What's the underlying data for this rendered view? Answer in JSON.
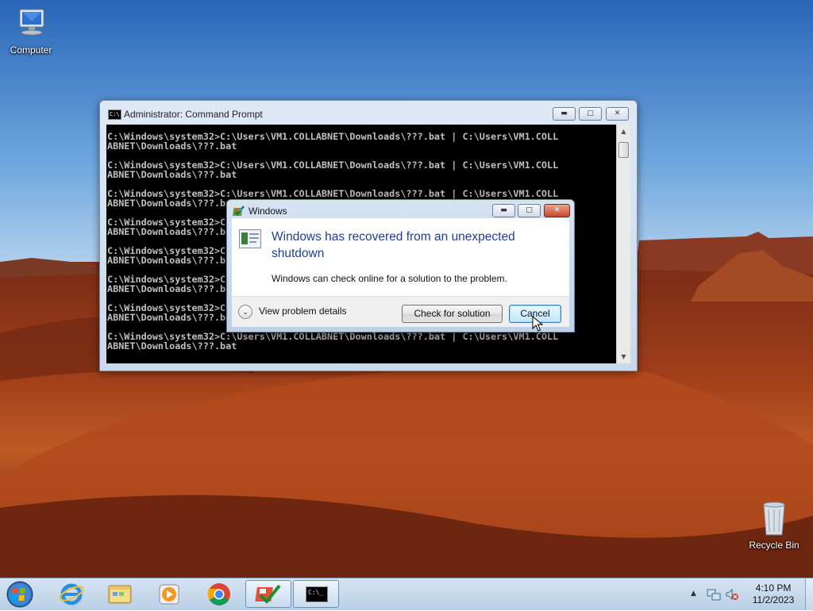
{
  "desktop": {
    "icons": [
      {
        "label": "Computer"
      },
      {
        "label": "Recycle Bin"
      }
    ]
  },
  "cmd_window": {
    "title": "Administrator: Command Prompt",
    "lines": [
      "C:\\Windows\\system32>C:\\Users\\VM1.COLLABNET\\Downloads\\???.bat | C:\\Users\\VM1.COLL",
      "ABNET\\Downloads\\???.bat",
      "",
      "C:\\Windows\\system32>C:\\Users\\VM1.COLLABNET\\Downloads\\???.bat | C:\\Users\\VM1.COLL",
      "ABNET\\Downloads\\???.bat",
      "",
      "C:\\Windows\\system32>C:\\Users\\VM1.COLLABNET\\Downloads\\???.bat | C:\\Users\\VM1.COLL",
      "ABNET\\Downloads\\???.bat",
      "",
      "C:\\Windows\\system32>C:\\Users\\VM1.COLLABNET\\Downloads\\???.bat | C:\\Users\\VM1.COLL",
      "ABNET\\Downloads\\???.bat",
      "",
      "C:\\Windows\\system32>C:\\Users\\VM1.COLLABNET\\Downloads\\???.bat | C:\\Users\\VM1.COLL",
      "ABNET\\Downloads\\???.bat",
      "",
      "C:\\Windows\\system32>C:\\Users\\VM1.COLLABNET\\Downloads\\???.bat | C:\\Users\\VM1.COLL",
      "ABNET\\Downloads\\???.bat",
      "",
      "C:\\Windows\\system32>C:\\Users\\VM1.COLLABNET\\Downloads\\???.bat | C:\\Users\\VM1.COLL",
      "ABNET\\Downloads\\???.bat",
      "",
      "C:\\Windows\\system32>C:\\Users\\VM1.COLLABNET\\Downloads\\???.bat | C:\\Users\\VM1.COLL",
      "ABNET\\Downloads\\???.bat"
    ],
    "scroll_position": 0.05
  },
  "dialog": {
    "title": "Windows",
    "heading": "Windows has recovered from an unexpected shutdown",
    "message": "Windows can check online for a solution to the problem.",
    "details_label": "View problem details",
    "check_button": "Check for solution",
    "cancel_button": "Cancel"
  },
  "taskbar": {
    "pinned": [
      {
        "icon": "internet-explorer-icon"
      },
      {
        "icon": "file-explorer-icon"
      },
      {
        "icon": "media-player-icon"
      },
      {
        "icon": "chrome-icon"
      },
      {
        "icon": "action-center-icon"
      },
      {
        "icon": "command-prompt-icon"
      }
    ],
    "cmd_icon_text": "C:\\_",
    "clock_time": "4:10 PM",
    "clock_date": "11/2/2023"
  },
  "colors": {
    "dialog_heading": "#1f3f94",
    "console_bg": "#000000",
    "console_text": "#c0c0c0"
  }
}
